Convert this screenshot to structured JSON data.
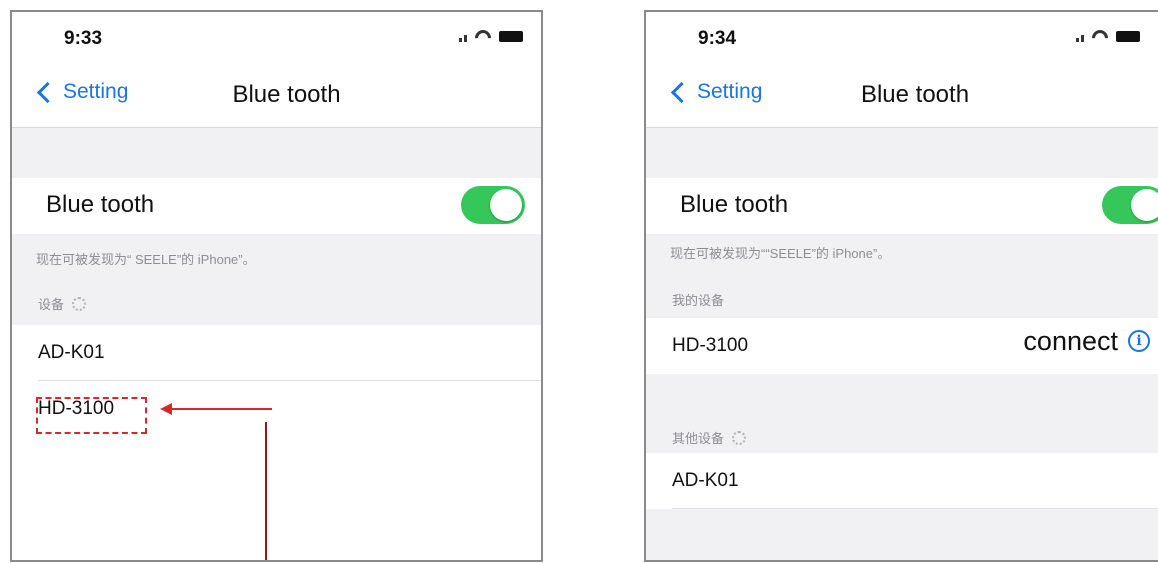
{
  "left": {
    "status_time": "9:33",
    "back_label": "Setting",
    "title": "Blue tooth",
    "bluetooth_label": "Blue tooth",
    "bluetooth_on": true,
    "discoverable_text": "现在可被发现为“ SEELE”的 iPhone”。",
    "section_devices": "设备",
    "devices": [
      {
        "name": "AD-K01"
      },
      {
        "name": "HD-3100"
      }
    ]
  },
  "right": {
    "status_time": "9:34",
    "back_label": "Setting",
    "title": "Blue tooth",
    "bluetooth_label": "Blue tooth",
    "bluetooth_on": true,
    "discoverable_text": "现在可被发现为““SEELE”的 iPhone”。",
    "section_my_devices": "我的设备",
    "my_devices": [
      {
        "name": "HD-3100",
        "status": "connect"
      }
    ],
    "section_other_devices": "其他设备",
    "other_devices": [
      {
        "name": "AD-K01"
      }
    ]
  },
  "colors": {
    "accent": "#1a73e8",
    "toggle_on": "#35c759",
    "annotation": "#d8282f"
  }
}
